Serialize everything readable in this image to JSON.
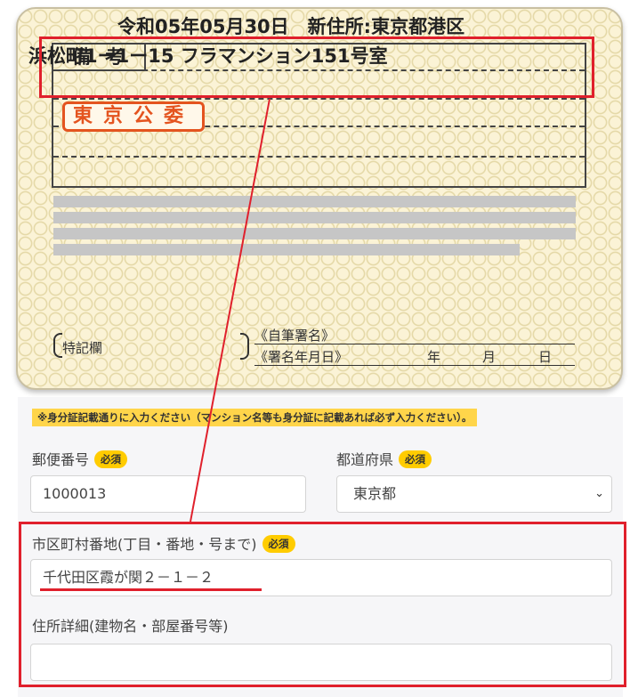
{
  "card": {
    "remarks_label": "備考",
    "remarks_line1": "令和05年05月30日　新住所:東京都港区",
    "remarks_line2": "浜松町1ー1ー15 フラマンション151号室",
    "stamp": "東京公委",
    "special_label": "特記欄",
    "signature_label": "《自筆署名》",
    "signature_date_label": "《署名年月日》",
    "year": "年",
    "month": "月",
    "day": "日"
  },
  "form": {
    "notice": "※身分証記載通りに入力ください（マンション名等も身分証に記載あれば必ず入力ください）。",
    "required_badge": "必須",
    "postal": {
      "label": "郵便番号",
      "value": "1000013"
    },
    "prefecture": {
      "label": "都道府県",
      "value": "東京都"
    },
    "city": {
      "label": "市区町村番地(丁目・番地・号まで)",
      "value": "千代田区霞が関２－１－２"
    },
    "detail": {
      "label": "住所詳細(建物名・部屋番号等)",
      "value": ""
    }
  },
  "colors": {
    "annotation": "#e0202c",
    "badge": "#ffcc00",
    "stamp": "#e4541f"
  }
}
